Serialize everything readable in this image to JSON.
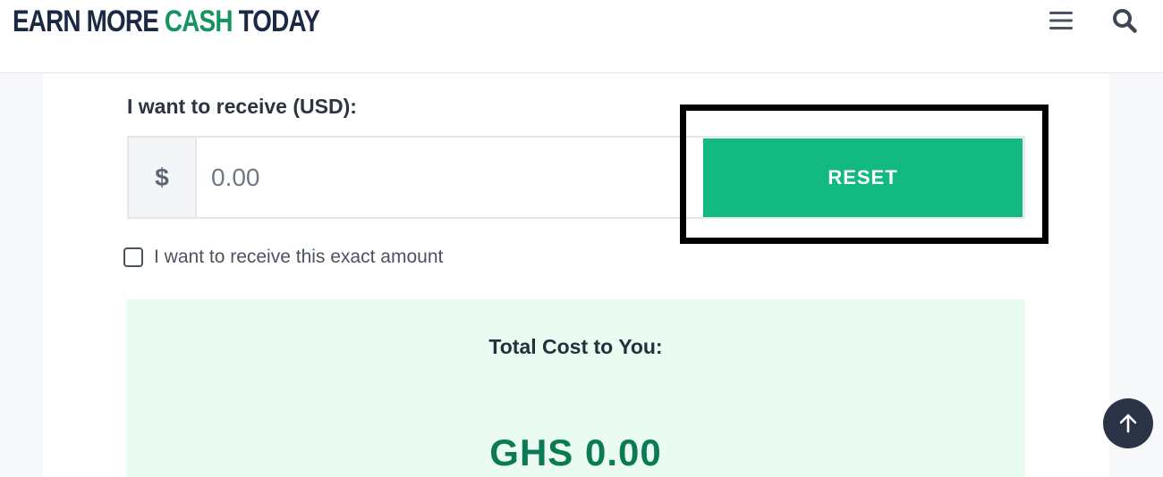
{
  "header": {
    "logo_part1": "EARN MORE ",
    "logo_part2": "CASH",
    "logo_part3": " TODAY",
    "menu_icon": "hamburger-menu-icon",
    "search_icon": "search-icon"
  },
  "form": {
    "label": "I want to receive (USD):",
    "currency_symbol": "$",
    "amount_placeholder": "0.00",
    "reset_label": "RESET",
    "exact_amount_label": "I want to receive this exact amount",
    "exact_amount_checked": false
  },
  "result": {
    "title": "Total Cost to You:",
    "value": "GHS 0.00"
  },
  "colors": {
    "accent": "#12b981",
    "result_value": "#0b7a55",
    "logo_dark": "#1b2a44",
    "logo_green": "#14955f"
  },
  "back_to_top_icon": "arrow-up-icon"
}
